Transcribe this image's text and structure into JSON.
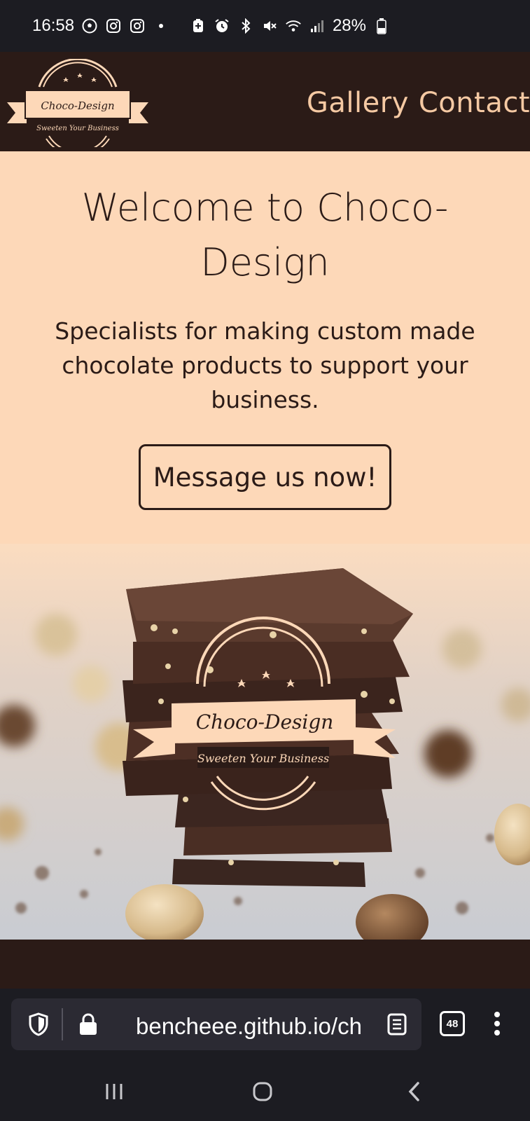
{
  "status_bar": {
    "time": "16:58",
    "battery": "28%",
    "left_icons": [
      "soccer-ball-icon",
      "instagram-icon",
      "instagram-icon",
      "dot-icon"
    ],
    "right_icons": [
      "battery-saver-icon",
      "alarm-icon",
      "bluetooth-icon",
      "mute-icon",
      "wifi-icon",
      "signal-icon",
      "battery-icon"
    ]
  },
  "site": {
    "logo": {
      "name": "Choco-Design",
      "tagline": "Sweeten Your Business"
    },
    "nav": [
      {
        "label": "Gallery"
      },
      {
        "label": "Contact"
      }
    ]
  },
  "hero": {
    "title": "Welcome to Choco-Design",
    "title_line1": "Welcome to Choco-",
    "title_line2": "Design",
    "subtitle_line1": "Specialists for making custom made",
    "subtitle_line2": "chocolate products to support your",
    "subtitle_line3": "business.",
    "cta_label": "Message us now!"
  },
  "photo": {
    "description_icon": "chocolate-stack-photo",
    "logo_name": "Choco-Design",
    "logo_tagline": "Sweeten Your Business"
  },
  "browser": {
    "url": "bencheee.github.io/ch",
    "tabs_count": "48",
    "icons": [
      "shield-icon",
      "lock-icon",
      "reader-icon",
      "tabs-icon",
      "more-icon"
    ]
  },
  "colors": {
    "header_bg": "#2b1b17",
    "hero_bg": "#fdd8b8",
    "nav_text": "#f5c9a3",
    "text_dark": "#2b1b17"
  }
}
